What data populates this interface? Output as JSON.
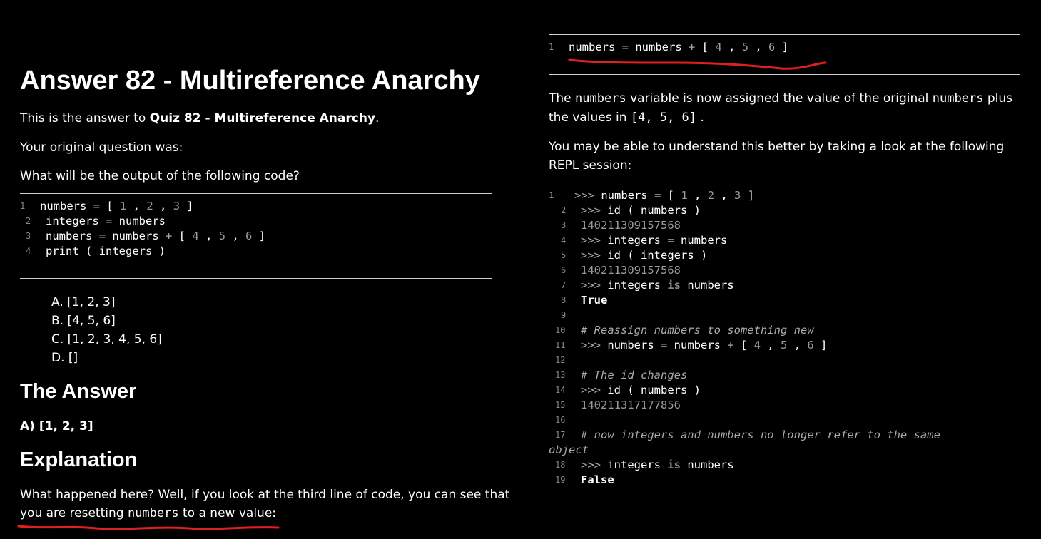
{
  "left": {
    "title": "Answer 82 - Multireference Anarchy",
    "intro_prefix": "This is the answer to ",
    "intro_link": "Quiz 82 - Multireference Anarchy",
    "intro_suffix": ".",
    "original_question_label": "Your original question was:",
    "question": "What will be the output of the following code?",
    "code_lines": [
      {
        "n": "1",
        "text": "numbers = [ 1 , 2 , 3 ]"
      },
      {
        "n": "2",
        "text": "integers = numbers"
      },
      {
        "n": "3",
        "text": "numbers = numbers + [ 4 , 5 , 6 ]"
      },
      {
        "n": "4",
        "text": "print ( integers )"
      }
    ],
    "choices": [
      "A. [1, 2, 3]",
      "B. [4, 5, 6]",
      "C. [1, 2, 3, 4, 5, 6]",
      "D. []"
    ],
    "answer_heading": "The Answer",
    "answer": "A) [1, 2, 3]",
    "explanation_heading": "Explanation",
    "explanation_line1": "What happened here? Well, if you look at the third line of code, you can see that",
    "explanation_line2_prefix": "you are resetting ",
    "explanation_line2_code": "numbers",
    "explanation_line2_suffix": " to a new value:"
  },
  "right": {
    "top_code": {
      "n": "1",
      "text": "numbers = numbers + [ 4 , 5 , 6 ]"
    },
    "para1_a": "The ",
    "para1_code1": "numbers",
    "para1_b": " variable is now assigned the value of the original ",
    "para1_code2": "numbers",
    "para1_c": " plus",
    "para1_d": "the values in ",
    "para1_code3": "[4, 5, 6]",
    "para1_e": ".",
    "para2": "You may be able to understand this better by taking a look at the following REPL session:",
    "repl": [
      {
        "n": "1",
        "text": ">>> numbers = [ 1 , 2 , 3 ]"
      },
      {
        "n": "2",
        "text": ">>> id ( numbers )"
      },
      {
        "n": "3",
        "text": "140211309157568"
      },
      {
        "n": "4",
        "text": ">>> integers = numbers"
      },
      {
        "n": "5",
        "text": ">>> id ( integers )"
      },
      {
        "n": "6",
        "text": "140211309157568"
      },
      {
        "n": "7",
        "text": ">>> integers is numbers"
      },
      {
        "n": "8",
        "text": "True"
      },
      {
        "n": "9",
        "text": ""
      },
      {
        "n": "10",
        "text": "# Reassign numbers to something new"
      },
      {
        "n": "11",
        "text": ">>> numbers = numbers + [ 4 , 5 , 6 ]"
      },
      {
        "n": "12",
        "text": ""
      },
      {
        "n": "13",
        "text": "# The id changes"
      },
      {
        "n": "14",
        "text": ">>> id ( numbers )"
      },
      {
        "n": "15",
        "text": "140211317177856"
      },
      {
        "n": "16",
        "text": ""
      },
      {
        "n": "17",
        "text": "# now integers and numbers no longer refer to the same"
      },
      {
        "n": "",
        "text": "object"
      },
      {
        "n": "18",
        "text": ">>> integers is numbers"
      },
      {
        "n": "19",
        "text": "False"
      }
    ]
  },
  "colors": {
    "background": "#000000",
    "text": "#ffffff",
    "annotation": "#e0201c"
  }
}
